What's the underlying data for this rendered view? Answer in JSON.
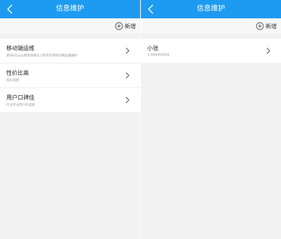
{
  "left": {
    "nav": {
      "title": "信息维护"
    },
    "toolbar": {
      "add_label": "新增"
    },
    "items": [
      {
        "title": "移动端运维",
        "subtitle": "爱快e云app和爱快微云小程序支持移动端运维维护"
      },
      {
        "title": "性价比高",
        "subtitle": "低价高配"
      },
      {
        "title": "用户口碑佳",
        "subtitle": "行业专业用户的选择"
      }
    ]
  },
  "right": {
    "nav": {
      "title": "信息维护"
    },
    "toolbar": {
      "add_label": "新增"
    },
    "items": [
      {
        "title": "小张",
        "subtitle": "17666666666"
      }
    ]
  },
  "colors": {
    "nav_bg": "#1d9bf0",
    "page_bg": "#f2f2f2",
    "item_bg": "#ffffff"
  },
  "icons": {
    "back": "chevron-left-icon",
    "add": "plus-circle-icon",
    "chevron": "chevron-right-icon"
  }
}
